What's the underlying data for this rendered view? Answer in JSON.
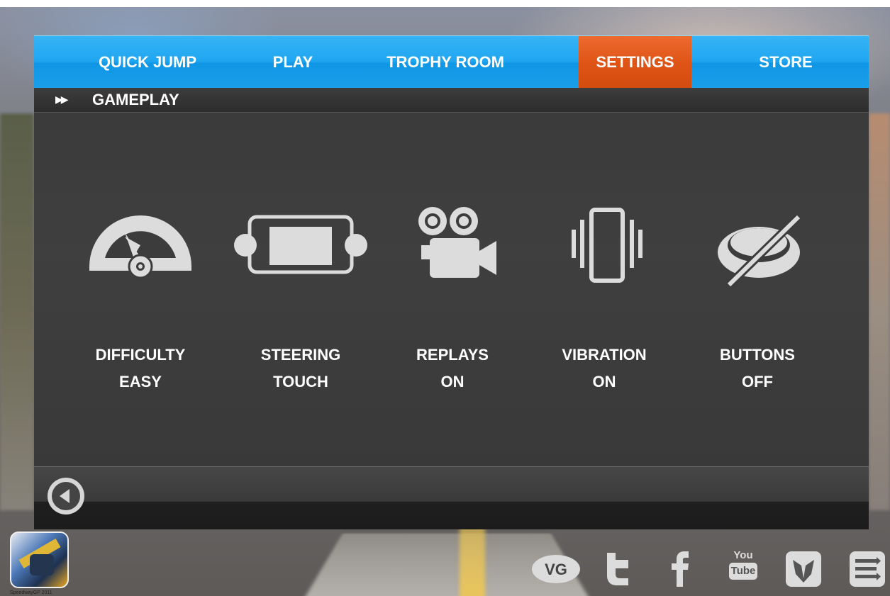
{
  "nav": {
    "tabs": [
      {
        "label": "QUICK  JUMP",
        "active": false
      },
      {
        "label": "PLAY",
        "active": false
      },
      {
        "label": "TROPHY  ROOM",
        "active": false
      },
      {
        "label": "SETTINGS",
        "active": true
      },
      {
        "label": "STORE",
        "active": false
      }
    ]
  },
  "section": {
    "arrows": "▶▶",
    "title": "GAMEPLAY"
  },
  "options": [
    {
      "name": "DIFFICULTY",
      "value": "EASY",
      "icon": "speedometer-icon"
    },
    {
      "name": "STEERING",
      "value": "TOUCH",
      "icon": "tablet-icon"
    },
    {
      "name": "REPLAYS",
      "value": "ON",
      "icon": "video-camera-icon"
    },
    {
      "name": "VIBRATION",
      "value": "ON",
      "icon": "vibrate-phone-icon"
    },
    {
      "name": "BUTTONS",
      "value": "OFF",
      "icon": "buttons-off-icon"
    }
  ],
  "app": {
    "caption": "SpeedwayGP 2011"
  },
  "social": [
    {
      "icon": "vg-icon"
    },
    {
      "icon": "twitter-icon"
    },
    {
      "icon": "facebook-icon"
    },
    {
      "label_top": "You",
      "label_bottom": "Tube",
      "icon": "youtube-icon"
    },
    {
      "icon": "brand-logo-icon"
    },
    {
      "icon": "menu-list-icon"
    }
  ],
  "colors": {
    "nav_blue": "#1fa6f1",
    "nav_active": "#df5517",
    "panel": "#3c3c3c",
    "icon": "#dcdcdc"
  }
}
